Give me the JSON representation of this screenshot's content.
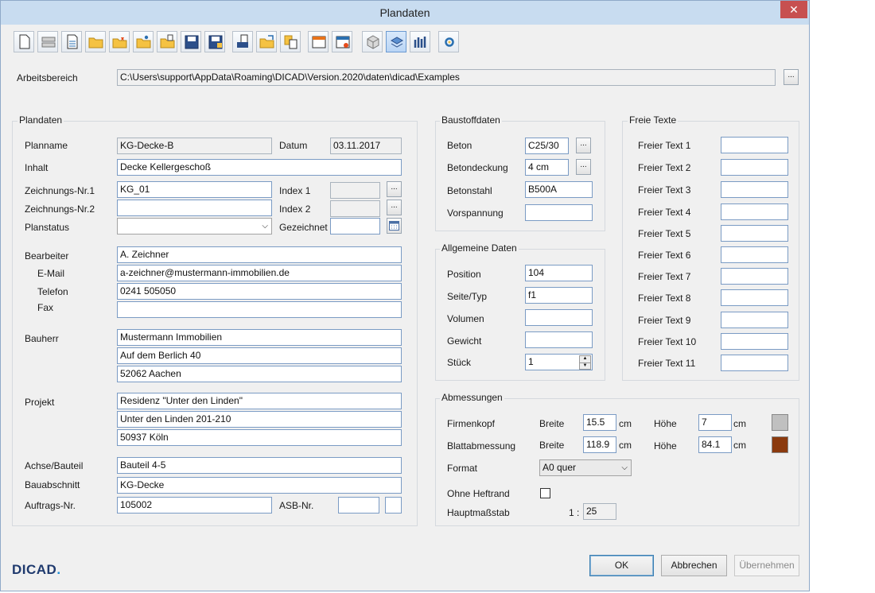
{
  "window": {
    "title": "Plandaten",
    "close_label": "✕"
  },
  "toolbar": [
    "new-file-icon",
    "layer-icon",
    "document-grid-icon",
    "open-folder-icon",
    "open-folder-star-icon",
    "open-folder-person-icon",
    "open-folder-doc-icon",
    "save-icon",
    "save-as-icon",
    "print-doc-icon",
    "export-folder-icon",
    "copy-docs-icon",
    "window-orange-icon",
    "window-settings-icon",
    "cube-icon",
    "sheet-3d-icon",
    "columns-icon",
    "gear-icon"
  ],
  "workspace": {
    "label": "Arbeitsbereich",
    "path": "C:\\Users\\support\\AppData\\Roaming\\DICAD\\Version.2020\\daten\\dicad\\Examples",
    "browse": "..."
  },
  "plandaten": {
    "title": "Plandaten",
    "planname_label": "Planname",
    "planname": "KG-Decke-B",
    "datum_label": "Datum",
    "datum": "03.11.2017",
    "inhalt_label": "Inhalt",
    "inhalt": "Decke Kellergeschoß",
    "znr1_label": "Zeichnungs-Nr.1",
    "znr1": "KG_01",
    "index1_label": "Index 1",
    "znr2_label": "Zeichnungs-Nr.2",
    "znr2": "",
    "index2_label": "Index 2",
    "planstatus_label": "Planstatus",
    "planstatus": "",
    "gezeichnet_label": "Gezeichnet",
    "gezeichnet": "",
    "bearbeiter_label": "Bearbeiter",
    "bearbeiter": "A. Zeichner",
    "email_label": "E-Mail",
    "email": "a-zeichner@mustermann-immobilien.de",
    "telefon_label": "Telefon",
    "telefon": "0241 505050",
    "fax_label": "Fax",
    "fax": "",
    "bauherr_label": "Bauherr",
    "bauherr": [
      "Mustermann Immobilien",
      "Auf dem Berlich 40",
      "52062 Aachen"
    ],
    "projekt_label": "Projekt",
    "projekt": [
      "Residenz \"Unter den Linden\"",
      "Unter den Linden 201-210",
      "50937 Köln"
    ],
    "achse_label": "Achse/Bauteil",
    "achse": "Bauteil 4-5",
    "bauabschnitt_label": "Bauabschnitt",
    "bauabschnitt": "KG-Decke",
    "auftrag_label": "Auftrags-Nr.",
    "auftrag": "105002",
    "asb_label": "ASB-Nr.",
    "asb": "",
    "asb2": ""
  },
  "baustoff": {
    "title": "Baustoffdaten",
    "beton_label": "Beton",
    "beton": "C25/30",
    "deckung_label": "Betondeckung",
    "deckung": "4 cm",
    "stahl_label": "Betonstahl",
    "stahl": "B500A",
    "vorspannung_label": "Vorspannung",
    "vorspannung": ""
  },
  "allgemein": {
    "title": "Allgemeine Daten",
    "position_label": "Position",
    "position": "104",
    "seite_label": "Seite/Typ",
    "seite": "f1",
    "volumen_label": "Volumen",
    "volumen": "",
    "gewicht_label": "Gewicht",
    "gewicht": "",
    "stueck_label": "Stück",
    "stueck": "1"
  },
  "freie": {
    "title": "Freie Texte",
    "items": [
      {
        "label": "Freier Text 1",
        "value": ""
      },
      {
        "label": "Freier Text 2",
        "value": ""
      },
      {
        "label": "Freier Text 3",
        "value": ""
      },
      {
        "label": "Freier Text 4",
        "value": ""
      },
      {
        "label": "Freier Text 5",
        "value": ""
      },
      {
        "label": "Freier Text 6",
        "value": ""
      },
      {
        "label": "Freier Text 7",
        "value": ""
      },
      {
        "label": "Freier Text 8",
        "value": ""
      },
      {
        "label": "Freier Text 9",
        "value": ""
      },
      {
        "label": "Freier Text 10",
        "value": ""
      },
      {
        "label": "Freier Text 11",
        "value": ""
      }
    ]
  },
  "abmessungen": {
    "title": "Abmessungen",
    "firmenkopf_label": "Firmenkopf",
    "breite_label": "Breite",
    "hoehe_label": "Höhe",
    "unit": "cm",
    "firmenkopf_breite": "15.5",
    "firmenkopf_hoehe": "7",
    "firmenkopf_color": "#c0c0c0",
    "blatt_label": "Blattabmessung",
    "blatt_breite": "118.9",
    "blatt_hoehe": "84.1",
    "blatt_color": "#8b3a0e",
    "format_label": "Format",
    "format": "A0 quer",
    "heftrand_label": "Ohne Heftrand",
    "heftrand_checked": false,
    "massstab_label": "Hauptmaßstab",
    "massstab_prefix": "1 :",
    "massstab": "25"
  },
  "buttons": {
    "ok": "OK",
    "abbrechen": "Abbrechen",
    "uebernehmen": "Übernehmen"
  },
  "brand": {
    "logo": "DICAD",
    "color": "#1f3a6e",
    "dot_color": "#1f8fd6"
  }
}
